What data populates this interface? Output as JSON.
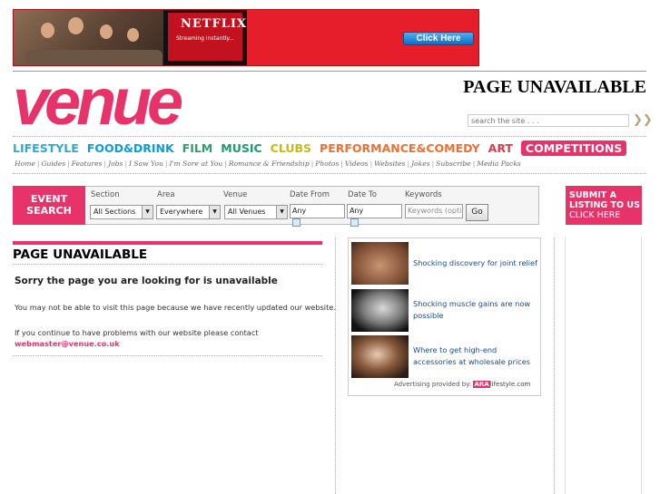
{
  "banner": {
    "brand": "NETFLIX",
    "tagline": "Streaming instantly...",
    "cta": "Click Here"
  },
  "header": {
    "logo": "venue",
    "page_title": "PAGE UNAVAILABLE",
    "search_placeholder": "search the site . . ."
  },
  "nav": {
    "items": [
      "LIFESTYLE",
      "FOOD&DRINK",
      "FILM",
      "MUSIC",
      "CLUBS",
      "PERFORMANCE&COMEDY",
      "ART",
      "COMPETITIONS"
    ]
  },
  "subnav": {
    "items": [
      "Home",
      "Guides",
      "Features",
      "Jobs",
      "I Saw You",
      "I'm Sore at You",
      "Romance & Friendship",
      "Photos",
      "Videos",
      "Websites",
      "Jokes",
      "Subscribe",
      "Media Packs"
    ]
  },
  "event_search": {
    "badge_line1": "EVENT",
    "badge_line2": "SEARCH",
    "section_label": "Section",
    "section_value": "All Sections",
    "area_label": "Area",
    "area_value": "Everywhere",
    "venue_label": "Venue",
    "venue_value": "All Venues",
    "date_from_label": "Date From",
    "date_from_value": "Any",
    "date_to_label": "Date To",
    "date_to_value": "Any",
    "keywords_label": "Keywords",
    "keywords_placeholder": "Keywords (optic",
    "go": "Go"
  },
  "submit": {
    "line1": "SUBMIT A",
    "line2": "LISTING TO US",
    "line3": "CLICK HERE"
  },
  "main": {
    "heading": "PAGE UNAVAILABLE",
    "sorry": "Sorry the page you are looking for is unavailable",
    "para1": "You may not be able to visit this page because we have recently updated our website.",
    "para2": "If you continue to have problems with our website please contact",
    "email": "webmaster@venue.co.uk"
  },
  "ads": {
    "items": [
      {
        "text": "Shocking discovery for joint relief"
      },
      {
        "text": "Shocking muscle gains are now possible"
      },
      {
        "text": "Where to get high-end accessories at wholesale prices"
      }
    ],
    "credit": "Advertising provided by:",
    "credit_brand_a": "ARA",
    "credit_brand_b": "lifestyle.com"
  },
  "colors": {
    "brand_pink": "#e8326a",
    "link_blue": "#1a4a8a"
  }
}
